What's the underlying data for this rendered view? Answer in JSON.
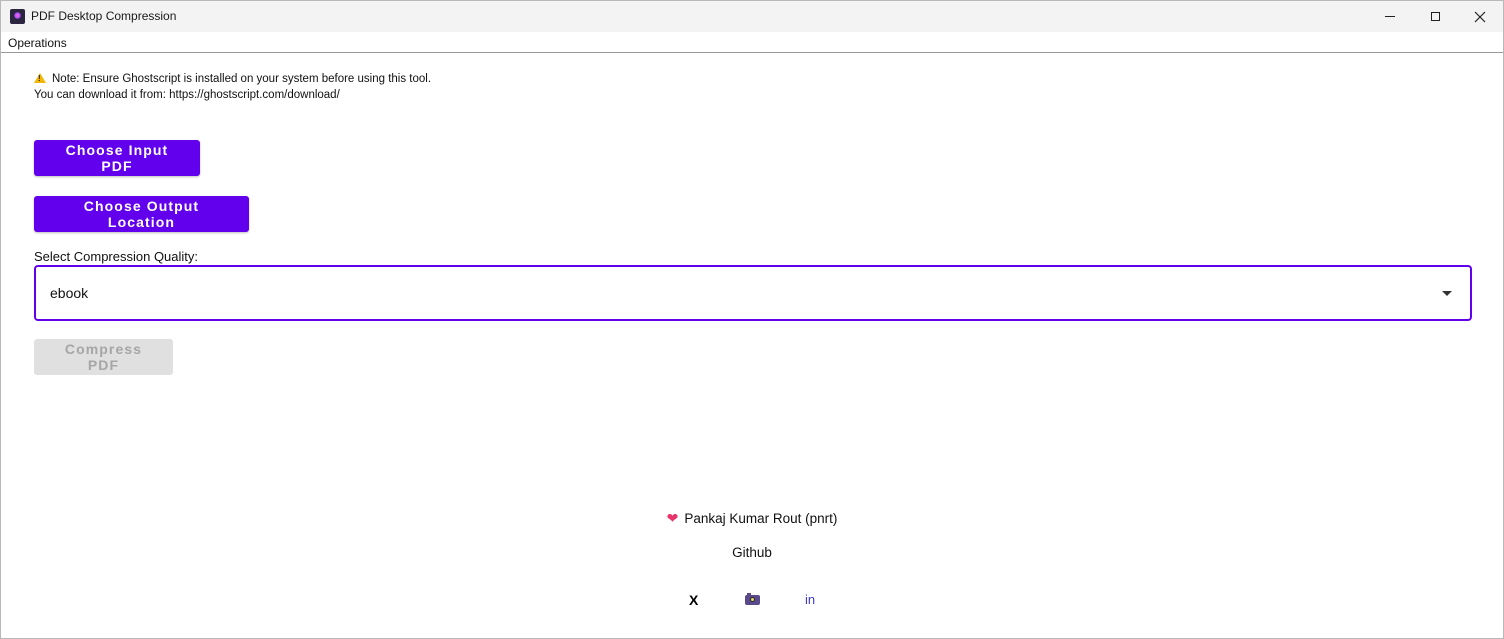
{
  "window": {
    "title": "PDF Desktop Compression"
  },
  "menu": {
    "operations_label": "Operations"
  },
  "note": {
    "line1": "Note: Ensure Ghostscript is installed on your system before using this tool.",
    "line2": "You can download it from: https://ghostscript.com/download/"
  },
  "buttons": {
    "choose_input": "Choose Input PDF",
    "choose_output": "Choose Output Location",
    "compress": "Compress PDF"
  },
  "compression": {
    "label": "Select Compression Quality:",
    "selected": "ebook"
  },
  "footer": {
    "author": "Pankaj Kumar Rout (pnrt)",
    "github": "Github",
    "social_x": "X",
    "social_linkedin": "in"
  },
  "colors": {
    "accent": "#6200ee",
    "disabled_bg": "#e0e0e0",
    "disabled_text": "#a6a6a6",
    "heart": "#e8336b",
    "link_blue": "#3a3ad6"
  },
  "icons": {
    "app": "app-icon",
    "warning": "warning-icon",
    "dropdown": "chevron-down-icon",
    "heart": "heart-icon",
    "camera": "camera-icon"
  }
}
